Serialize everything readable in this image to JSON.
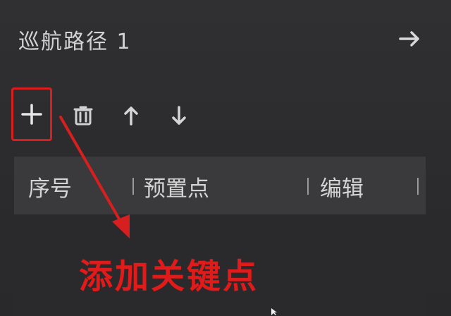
{
  "panel": {
    "title": "巡航路径 1"
  },
  "toolbar": {
    "add_icon": "plus-icon",
    "delete_icon": "trash-icon",
    "move_up_icon": "arrow-up-icon",
    "move_down_icon": "arrow-down-icon",
    "next_icon": "arrow-right-icon"
  },
  "table": {
    "columns": [
      "序号",
      "预置点",
      "编辑"
    ]
  },
  "annotation": {
    "text": "添加关键点",
    "color": "#e11a1a"
  }
}
